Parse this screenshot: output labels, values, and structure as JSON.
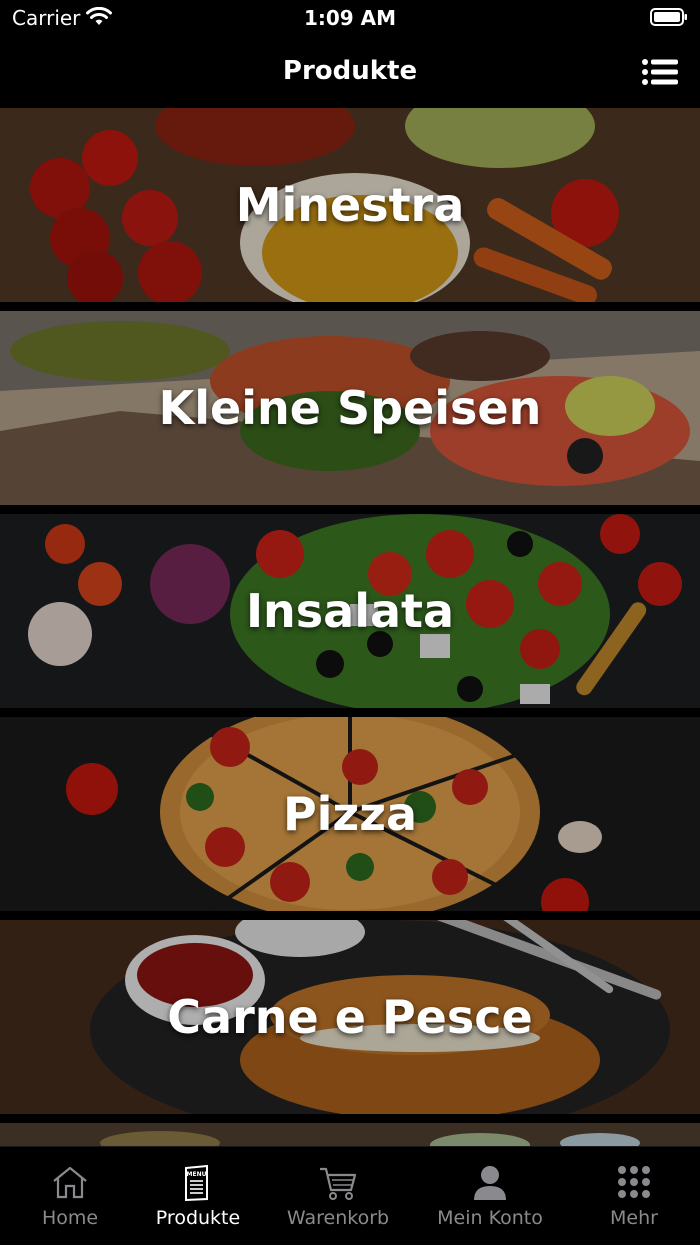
{
  "status_bar": {
    "carrier": "Carrier",
    "time": "1:09 AM",
    "icons": [
      "wifi-icon",
      "battery-icon"
    ]
  },
  "nav": {
    "title": "Produkte",
    "right_icon": "list-icon"
  },
  "categories": [
    {
      "label": "Minestra"
    },
    {
      "label": "Kleine Speisen"
    },
    {
      "label": "Insalata"
    },
    {
      "label": "Pizza"
    },
    {
      "label": "Carne e Pesce"
    }
  ],
  "tab_bar": {
    "active_color": "#ffffff",
    "inactive_color": "#8a8a8e",
    "items": [
      {
        "label": "Home",
        "icon": "home-icon",
        "active": false
      },
      {
        "label": "Produkte",
        "icon": "menu-card-icon",
        "active": true
      },
      {
        "label": "Warenkorb",
        "icon": "cart-icon",
        "active": false
      },
      {
        "label": "Mein Konto",
        "icon": "user-icon",
        "active": false
      },
      {
        "label": "Mehr",
        "icon": "grid-icon",
        "active": false
      }
    ]
  }
}
